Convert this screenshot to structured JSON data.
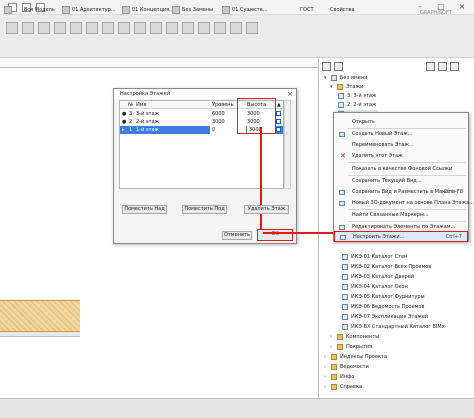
{
  "window": {
    "close_glyph": "×",
    "minimize_glyph": "–",
    "maximize_glyph": "□"
  },
  "status_bar": {
    "items": [
      "Вся Модель",
      "01 Архитектур...",
      "01 Концепция...",
      "Без Замены",
      "01 Существ...",
      "ГОСТ"
    ],
    "end_label": "Свойства",
    "watermark": "GRAPHISOFT"
  },
  "dialog": {
    "title": "Настройка Этажей",
    "close_glyph": "×",
    "columns": {
      "num": "№",
      "name": "Имя",
      "level": "Уровень",
      "height": "Высота",
      "show": "▲"
    },
    "rows": [
      {
        "num": "3",
        "name": "3-й этаж",
        "level": "6000",
        "height": "3000"
      },
      {
        "num": "2",
        "name": "2-й этаж",
        "level": "3000",
        "height": "3000"
      },
      {
        "num": "1",
        "name": "1-й этаж",
        "level": "0",
        "height": "3000"
      }
    ],
    "buttons": {
      "insert_above": "Поместить Над",
      "insert_below": "Поместить Под",
      "delete": "Удалить Этаж",
      "cancel": "Отменить",
      "ok": "OK"
    }
  },
  "navigator": {
    "root": "Без имени",
    "stories_folder": "Этажи",
    "stories": [
      "3. 3-й этаж",
      "2. 2-й этаж"
    ],
    "lower_items": [
      "ИКЭ-01 Каталог Стен",
      "ИКЭ-02 Каталог Всех Проемов",
      "ИКЭ-03 Каталог Дверей",
      "ИКЭ-04 Каталог Окон",
      "ИКЭ-05 Каталог Фурнитуры",
      "ИКЭ-06 Ведомость Проемов",
      "ИКЭ-07 Экспликация Этажей",
      "ИКЭ-BX Стандартный Каталог BIMx",
      "Компоненты",
      "Покрытия",
      "Индексы Проекта",
      "Ведомости",
      "Инфо",
      "Справка"
    ]
  },
  "context_menu": {
    "items": [
      {
        "label": "Открыть",
        "shortcut": ""
      },
      {
        "label": "Создать Новый Этаж...",
        "shortcut": ""
      },
      {
        "label": "Переименовать Этаж...",
        "shortcut": ""
      },
      {
        "label": "Удалить этот Этаж",
        "shortcut": ""
      },
      {
        "label": "Показать в качестве Фоновой Ссылки",
        "shortcut": ""
      },
      {
        "label": "Сохранить Текущий Вид...",
        "shortcut": ""
      },
      {
        "label": "Сохранить Вид и Разместить в Макете",
        "shortcut": "Ctrl+F8"
      },
      {
        "label": "Новый 3D-документ на основе Плана Этажа...",
        "shortcut": ""
      },
      {
        "label": "Найти Связанные Маркеры...",
        "shortcut": ""
      },
      {
        "label": "Редактировать Элементы по Этажам...",
        "shortcut": ""
      },
      {
        "label": "Настроить Этажи...",
        "shortcut": "Ctrl+7"
      }
    ]
  },
  "colors": {
    "highlight_red": "#e11a1a",
    "selection_blue": "#3d7de0"
  }
}
